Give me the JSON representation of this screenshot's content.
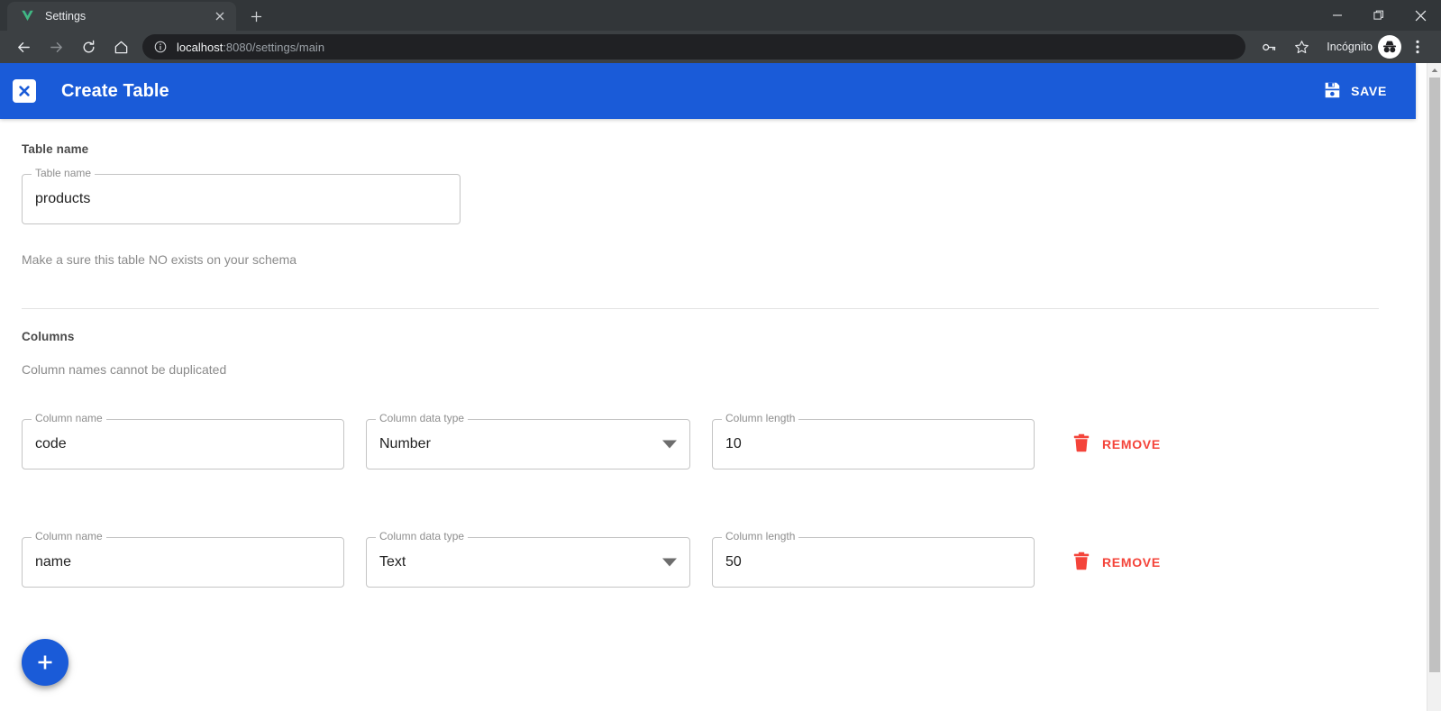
{
  "browser": {
    "tab": {
      "title": "Settings",
      "favicon_icon": "vue-logo-icon",
      "close_icon": "close-icon"
    },
    "new_tab_icon": "plus-icon",
    "window_controls": {
      "minimize_icon": "minimize-icon",
      "maximize_icon": "maximize-icon",
      "close_icon": "close-icon"
    },
    "nav": {
      "back_icon": "back-arrow-icon",
      "forward_icon": "forward-arrow-icon",
      "reload_icon": "reload-icon",
      "home_icon": "home-icon"
    },
    "omnibox": {
      "info_icon": "info-circle-icon",
      "url_host": "localhost",
      "url_rest": ":8080/settings/main"
    },
    "toolbar_right": {
      "password_icon": "key-icon",
      "bookmark_icon": "star-icon",
      "incognito_label": "Incógnito",
      "incognito_icon": "incognito-avatar-icon",
      "menu_icon": "three-dot-menu-icon"
    }
  },
  "app": {
    "appbar": {
      "close_icon": "close-x-icon",
      "title": "Create Table",
      "save_icon": "save-floppy-icon",
      "save_label": "SAVE"
    },
    "table_name_section": {
      "heading": "Table name",
      "field_label": "Table name",
      "field_value": "products",
      "hint": "Make a sure this table NO exists on your schema"
    },
    "columns_section": {
      "heading": "Columns",
      "hint": "Column names cannot be duplicated",
      "labels": {
        "name": "Column name",
        "type": "Column data type",
        "length": "Column length"
      },
      "remove_label": "REMOVE",
      "remove_icon": "trash-icon",
      "rows": [
        {
          "name": "code",
          "type": "Number",
          "length": "10"
        },
        {
          "name": "name",
          "type": "Text",
          "length": "50"
        }
      ]
    },
    "fab": {
      "icon": "plus-icon"
    },
    "colors": {
      "primary": "#1a5bd8",
      "danger": "#f4443a",
      "field_border": "#c4c4c4",
      "label_gray": "#8e8e8e"
    }
  },
  "scrollbar": {
    "up_arrow_icon": "chevron-up-icon"
  }
}
